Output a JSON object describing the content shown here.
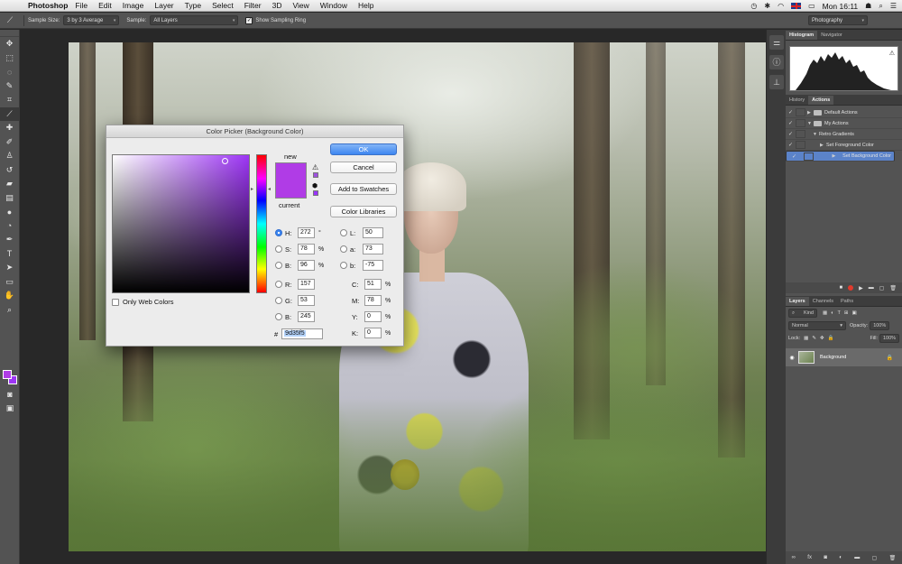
{
  "menubar": {
    "app_name": "Photoshop",
    "menus": [
      "File",
      "Edit",
      "Image",
      "Layer",
      "Type",
      "Select",
      "Filter",
      "3D",
      "View",
      "Window",
      "Help"
    ],
    "clock": "Mon 16:11"
  },
  "options_bar": {
    "sample_size_label": "Sample Size:",
    "sample_size_value": "3 by 3 Average",
    "sample_label": "Sample:",
    "sample_value": "All Layers",
    "show_ring_label": "Show Sampling Ring",
    "show_ring_checked": true,
    "workspace": "Photography"
  },
  "tools": {
    "foreground_color": "#b03ce6",
    "background_color": "#9d35f5"
  },
  "color_picker": {
    "title": "Color Picker (Background Color)",
    "new_label": "new",
    "current_label": "current",
    "ok": "OK",
    "cancel": "Cancel",
    "add_to_swatches": "Add to Swatches",
    "color_libraries": "Color Libraries",
    "only_web_colors": "Only Web Colors",
    "fields": {
      "H": "272",
      "S": "78",
      "B": "96",
      "R": "157",
      "G": "53",
      "Bl": "245",
      "L": "50",
      "a": "73",
      "b": "-75",
      "C": "51",
      "M": "78",
      "Y": "0",
      "K": "0"
    },
    "labels": {
      "H": "H:",
      "S": "S:",
      "B": "B:",
      "R": "R:",
      "G": "G:",
      "Bl": "B:",
      "L": "L:",
      "a": "a:",
      "b": "b:",
      "C": "C:",
      "M": "M:",
      "Y": "Y:",
      "K": "K:"
    },
    "units": {
      "deg": "°",
      "pct": "%"
    },
    "hex_label": "#",
    "hex": "9d35f5",
    "new_color": "#b03ce6",
    "hue_color": "#9d35f5"
  },
  "panels": {
    "top_tabs": [
      "Histogram",
      "Navigator"
    ],
    "action_tabs": [
      "History",
      "Actions"
    ],
    "actions": [
      {
        "name": "Default Actions",
        "type": "set",
        "checked": true
      },
      {
        "name": "My Actions",
        "type": "set",
        "checked": true
      },
      {
        "name": "Retro Gradients",
        "type": "action",
        "checked": true
      },
      {
        "name": "Set Foreground Color",
        "type": "step",
        "checked": true
      },
      {
        "name": "Set Background Color",
        "type": "step",
        "checked": true
      }
    ],
    "layer_tabs": [
      "Layers",
      "Channels",
      "Paths"
    ],
    "kind_label": "Kind",
    "blend_mode": "Normal",
    "opacity_label": "Opacity:",
    "opacity": "100%",
    "lock_label": "Lock:",
    "fill_label": "Fill:",
    "fill": "100%",
    "layer_name": "Background"
  }
}
